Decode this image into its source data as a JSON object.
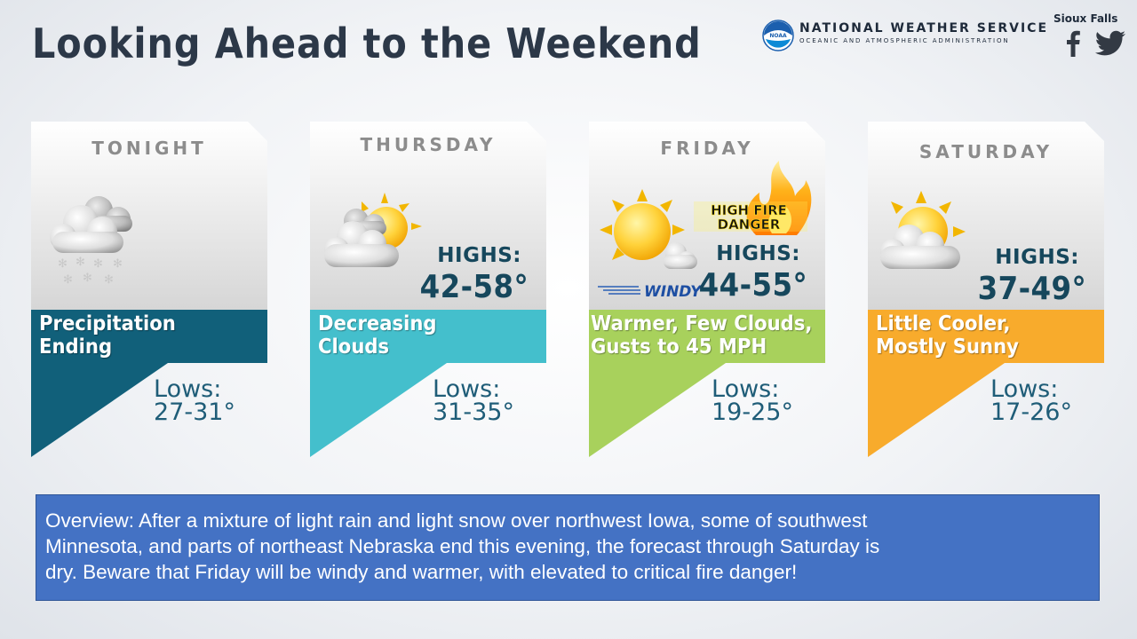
{
  "header": {
    "title": "Looking Ahead to the Weekend",
    "agency_name": "NATIONAL WEATHER SERVICE",
    "agency_sub": "OCEANIC AND ATMOSPHERIC ADMINISTRATION",
    "logo_text": "NOAA",
    "office": "Sioux Falls",
    "social_icons": [
      "facebook-icon",
      "twitter-icon"
    ]
  },
  "cards": [
    {
      "day": "TONIGHT",
      "icon": "snow-cloud-icon",
      "highs_label": "",
      "highs_value": "",
      "description_line1": "Precipitation",
      "description_line2": "Ending",
      "lows_label": "Lows:",
      "lows_value": "27-31°",
      "band_color": "#11607a"
    },
    {
      "day": "THURSDAY",
      "icon": "partly-cloudy-icon",
      "highs_label": "HIGHS:",
      "highs_value": "42-58°",
      "description_line1": "Decreasing",
      "description_line2": "Clouds",
      "lows_label": "Lows:",
      "lows_value": "31-35°",
      "band_color": "#44bfcc"
    },
    {
      "day": "FRIDAY",
      "icon": "mostly-sunny-icon",
      "badge_line1": "HIGH FIRE",
      "badge_line2": "DANGER",
      "windy_label": "WINDY",
      "highs_label": "HIGHS:",
      "highs_value": "44-55°",
      "description_line1": "Warmer, Few Clouds,",
      "description_line2": "Gusts to 45 MPH",
      "lows_label": "Lows:",
      "lows_value": "19-25°",
      "band_color": "#a8d15c"
    },
    {
      "day": "SATURDAY",
      "icon": "partly-sunny-icon",
      "highs_label": "HIGHS:",
      "highs_value": "37-49°",
      "description_line1": "Little Cooler,",
      "description_line2": "Mostly Sunny",
      "lows_label": "Lows:",
      "lows_value": "17-26°",
      "band_color": "#f8ab2c"
    }
  ],
  "overview": {
    "line1": "Overview: After a mixture of light rain and light snow over northwest Iowa, some of southwest",
    "line2": "Minnesota, and parts of northeast Nebraska end this evening, the forecast through Saturday is",
    "line3": "dry. Beware that Friday will be windy and warmer, with elevated to critical fire danger!"
  }
}
